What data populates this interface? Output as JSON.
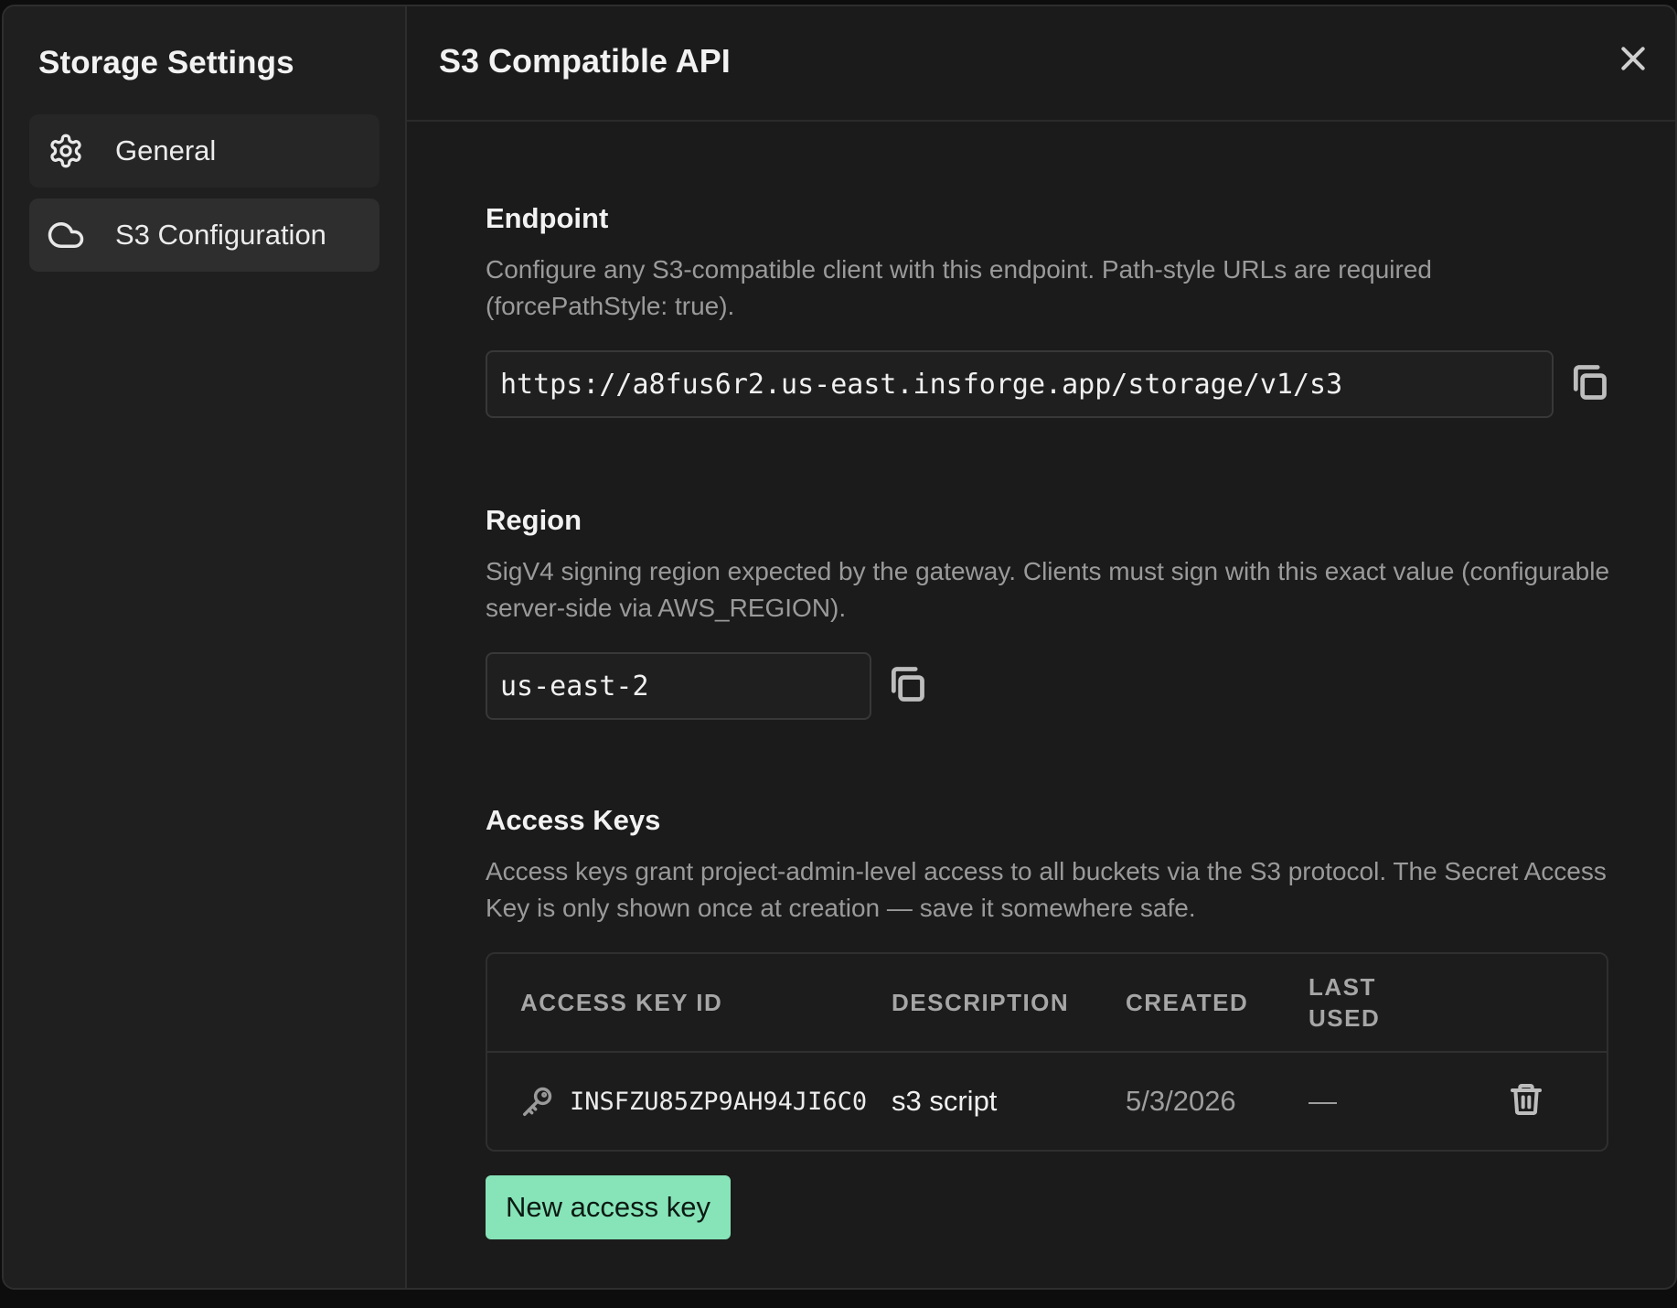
{
  "sidebar": {
    "title": "Storage Settings",
    "items": [
      {
        "label": "General",
        "icon": "gear-icon",
        "active": false
      },
      {
        "label": "S3 Configuration",
        "icon": "cloud-icon",
        "active": true
      }
    ]
  },
  "main": {
    "title": "S3 Compatible API",
    "endpoint": {
      "title": "Endpoint",
      "description": "Configure any S3-compatible client with this endpoint. Path-style URLs are required (forcePathStyle: true).",
      "value": "https://a8fus6r2.us-east.insforge.app/storage/v1/s3"
    },
    "region": {
      "title": "Region",
      "description": "SigV4 signing region expected by the gateway. Clients must sign with this exact value (configurable server-side via AWS_REGION).",
      "value": "us-east-2"
    },
    "access_keys": {
      "title": "Access Keys",
      "description": "Access keys grant project-admin-level access to all buckets via the S3 protocol. The Secret Access Key is only shown once at creation — save it somewhere safe.",
      "columns": [
        "ACCESS KEY ID",
        "DESCRIPTION",
        "CREATED",
        "LAST USED"
      ],
      "rows": [
        {
          "id": "INSFZU85ZP9AH94JI6C0",
          "description": "s3 script",
          "created": "5/3/2026",
          "last_used": "—"
        }
      ],
      "new_button_label": "New access key"
    }
  },
  "colors": {
    "background": "#1b1b1b",
    "sidebar_background": "#1f1f1f",
    "accent": "#86e4b8"
  }
}
